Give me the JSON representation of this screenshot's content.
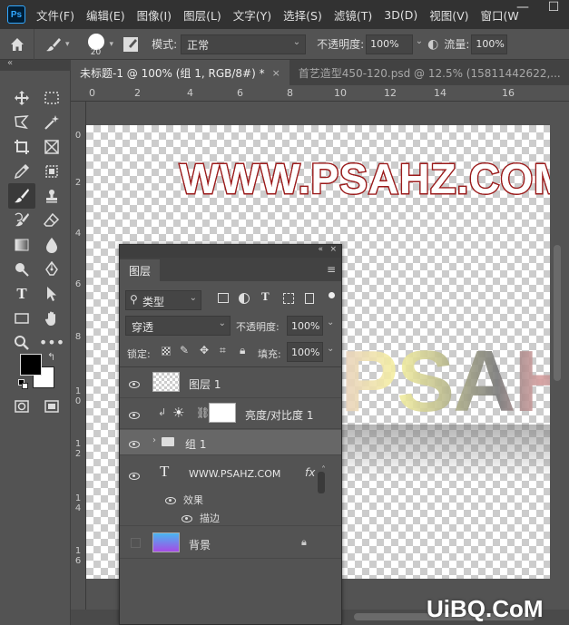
{
  "app": {
    "logo": "Ps"
  },
  "menu": [
    "文件(F)",
    "编辑(E)",
    "图像(I)",
    "图层(L)",
    "文字(Y)",
    "选择(S)",
    "滤镜(T)",
    "3D(D)",
    "视图(V)",
    "窗口(W"
  ],
  "window_controls": {
    "minimize": "—",
    "maximize": "☐"
  },
  "options": {
    "brush_size": "20",
    "mode_label": "模式:",
    "mode_value": "正常",
    "opacity_label": "不透明度:",
    "opacity_value": "100%",
    "flow_label": "流量:",
    "flow_value": "100%"
  },
  "collapse_glyph": "«",
  "tabs": [
    {
      "label": "未标题-1 @ 100% (组 1, RGB/8#) *",
      "close": "×",
      "active": true
    },
    {
      "label": "首艺造型450-120.psd @ 12.5% (15811442622,...",
      "active": false
    }
  ],
  "ruler_top": [
    "0",
    "2",
    "4",
    "6",
    "8",
    "10",
    "12",
    "14",
    "16"
  ],
  "ruler_left": [
    "0",
    "2",
    "4",
    "6",
    "8",
    "1 0",
    "1 2",
    "1 4",
    "1 6"
  ],
  "canvas": {
    "watermark": "WWW.PSAHZ.COM",
    "art_text": "PSAHZ"
  },
  "layers_panel": {
    "collapse": "«",
    "close": "×",
    "tab": "图层",
    "menu_glyph": "≡",
    "filter_label": "类型",
    "blend_mode": "穿透",
    "opacity_label": "不透明度:",
    "opacity_value": "100%",
    "lock_label": "锁定:",
    "fill_label": "填充:",
    "fill_value": "100%",
    "layers": [
      {
        "name": "图层 1",
        "visible": true
      },
      {
        "name": "亮度/对比度 1",
        "visible": true
      },
      {
        "name": "组 1",
        "visible": true,
        "selected": true
      },
      {
        "name": "WWW.PSAHZ.COM",
        "visible": true,
        "fx": "fx"
      },
      {
        "name": "效果",
        "visible": true
      },
      {
        "name": "描边",
        "visible": true
      },
      {
        "name": "背景",
        "visible": false
      }
    ]
  },
  "colors": {
    "foreground": "#000000",
    "background": "#ffffff",
    "accent": "#31a8ff",
    "watermark_stroke": "#9b1b1b"
  },
  "watermark_corner": "UiBQ.CoM"
}
